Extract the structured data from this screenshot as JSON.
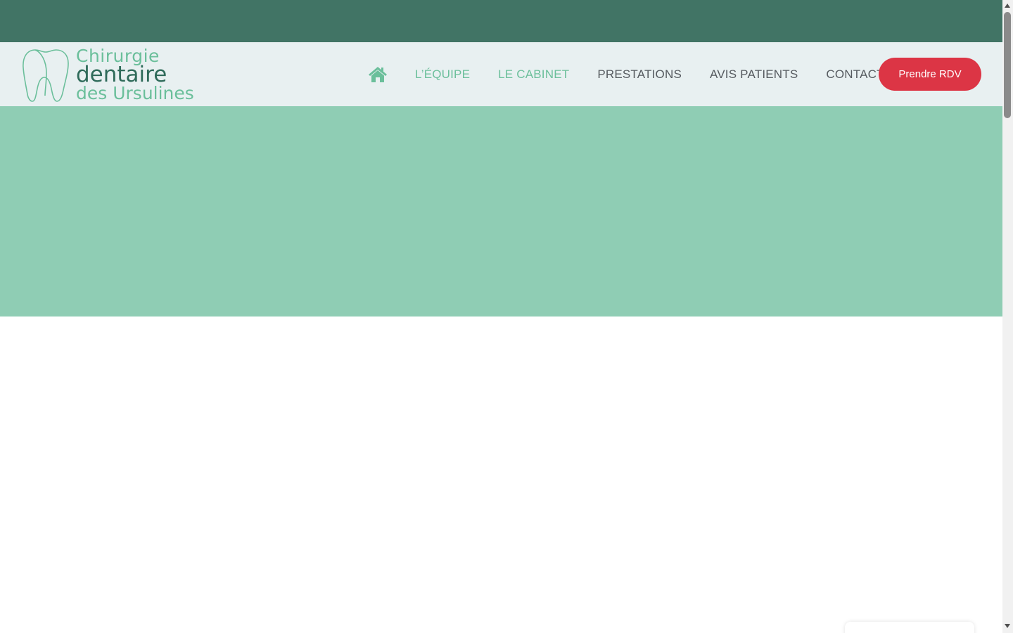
{
  "logo": {
    "line1": "Chirurgie",
    "line2": "dentaire",
    "line3": "des Ursulines",
    "icon": "tooth-icon"
  },
  "nav": {
    "home_icon": "home-icon",
    "items": [
      {
        "label": "L’ÉQUIPE",
        "active": true
      },
      {
        "label": "LE CABINET",
        "active": true
      },
      {
        "label": "PRESTATIONS",
        "active": false
      },
      {
        "label": "AVIS PATIENTS",
        "active": false
      },
      {
        "label": "CONTACT",
        "active": false
      }
    ],
    "cta_label": "Prendre RDV"
  },
  "colors": {
    "topbar": "#417465",
    "header_bg": "#e8f0f1",
    "hero_bg": "#8fcdb4",
    "accent_green": "#6bbf9b",
    "cta_red": "#dc3545"
  }
}
